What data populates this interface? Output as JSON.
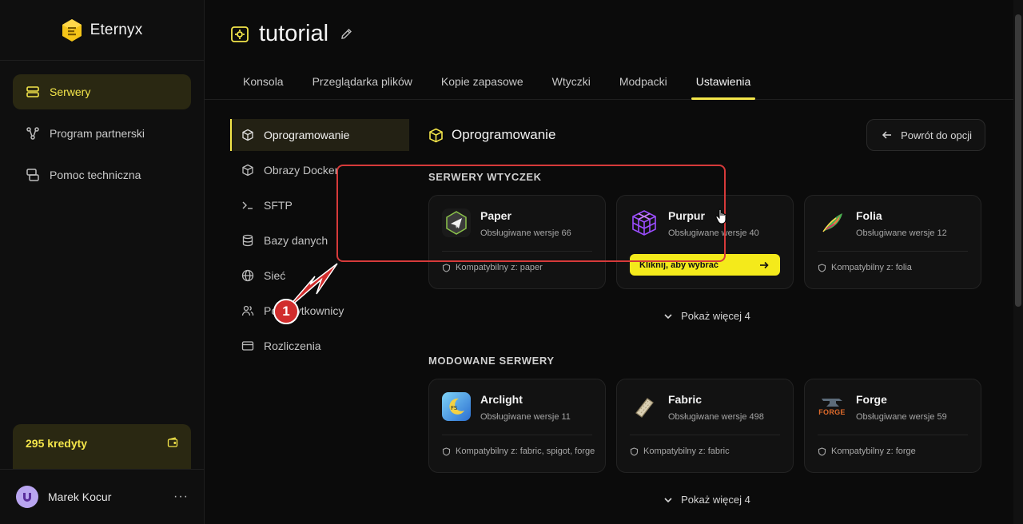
{
  "brand": {
    "name": "Eternyx"
  },
  "sidebar": {
    "items": [
      {
        "label": "Serwery",
        "icon": "server-icon",
        "active": true
      },
      {
        "label": "Program partnerski",
        "icon": "share-icon",
        "active": false
      },
      {
        "label": "Pomoc techniczna",
        "icon": "support-icon",
        "active": false
      }
    ],
    "credits": "295 kredyty",
    "user": {
      "name": "Marek Kocur",
      "menu": "···"
    }
  },
  "header": {
    "title": "tutorial",
    "tabs": [
      {
        "label": "Konsola",
        "active": false
      },
      {
        "label": "Przeglądarka plików",
        "active": false
      },
      {
        "label": "Kopie zapasowe",
        "active": false
      },
      {
        "label": "Wtyczki",
        "active": false
      },
      {
        "label": "Modpacki",
        "active": false
      },
      {
        "label": "Ustawienia",
        "active": true
      }
    ]
  },
  "settings_nav": [
    {
      "label": "Oprogramowanie",
      "icon": "cube-icon",
      "active": true
    },
    {
      "label": "Obrazy Docker",
      "icon": "docker-icon",
      "active": false
    },
    {
      "label": "SFTP",
      "icon": "terminal-icon",
      "active": false
    },
    {
      "label": "Bazy danych",
      "icon": "database-icon",
      "active": false
    },
    {
      "label": "Sieć",
      "icon": "globe-icon",
      "active": false
    },
    {
      "label": "Podużytkownicy",
      "icon": "users-icon",
      "active": false
    },
    {
      "label": "Rozliczenia",
      "icon": "card-icon",
      "active": false
    }
  ],
  "main": {
    "title": "Oprogramowanie",
    "back_button": "Powrót do opcji",
    "groups": [
      {
        "title": "SERWERY WTYCZEK",
        "show_more": "Pokaż więcej 4",
        "cards": [
          {
            "name": "Paper",
            "versions": "Obsługiwane wersje 66",
            "compat": "Kompatybilny z: paper",
            "hovered": false
          },
          {
            "name": "Purpur",
            "versions": "Obsługiwane wersje 40",
            "select": "Kliknij, aby wybrać",
            "hovered": true
          },
          {
            "name": "Folia",
            "versions": "Obsługiwane wersje 12",
            "compat": "Kompatybilny z: folia",
            "hovered": false
          }
        ]
      },
      {
        "title": "MODOWANE SERWERY",
        "show_more": "Pokaż więcej 4",
        "cards": [
          {
            "name": "Arclight",
            "versions": "Obsługiwane wersje 11",
            "compat": "Kompatybilny z: fabric, spigot, forge",
            "hovered": false
          },
          {
            "name": "Fabric",
            "versions": "Obsługiwane wersje 498",
            "compat": "Kompatybilny z: fabric",
            "hovered": false
          },
          {
            "name": "Forge",
            "versions": "Obsługiwane wersje 59",
            "compat": "Kompatybilny z: forge",
            "hovered": false,
            "logo_text": "FORGE"
          }
        ]
      }
    ]
  },
  "annotation": {
    "badge": "1",
    "color": "#d63a3a"
  },
  "colors": {
    "accent": "#f4e64a",
    "background": "#0b0b0b",
    "card": "#121212"
  }
}
